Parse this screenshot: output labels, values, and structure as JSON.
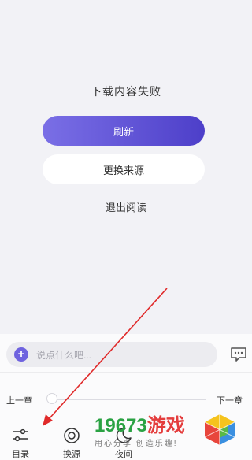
{
  "error": {
    "message": "下载内容失败",
    "refresh_label": "刷新",
    "change_source_label": "更换来源",
    "exit_label": "退出阅读"
  },
  "comment": {
    "placeholder": "说点什么吧..."
  },
  "chapter": {
    "prev_label": "上一章",
    "next_label": "下一章",
    "progress": 0
  },
  "tabs": [
    {
      "label": "目录",
      "icon": "toc-icon"
    },
    {
      "label": "换源",
      "icon": "change-source-icon"
    },
    {
      "label": "夜间",
      "icon": "night-mode-icon"
    }
  ],
  "watermark": {
    "title_digits": "19673",
    "title_word": "游戏",
    "subtitle": "用心分享 创造乐趣!"
  },
  "colors": {
    "accent_start": "#7a6fe6",
    "accent_end": "#4d3fc9",
    "annotation_arrow": "#e02a2a"
  }
}
